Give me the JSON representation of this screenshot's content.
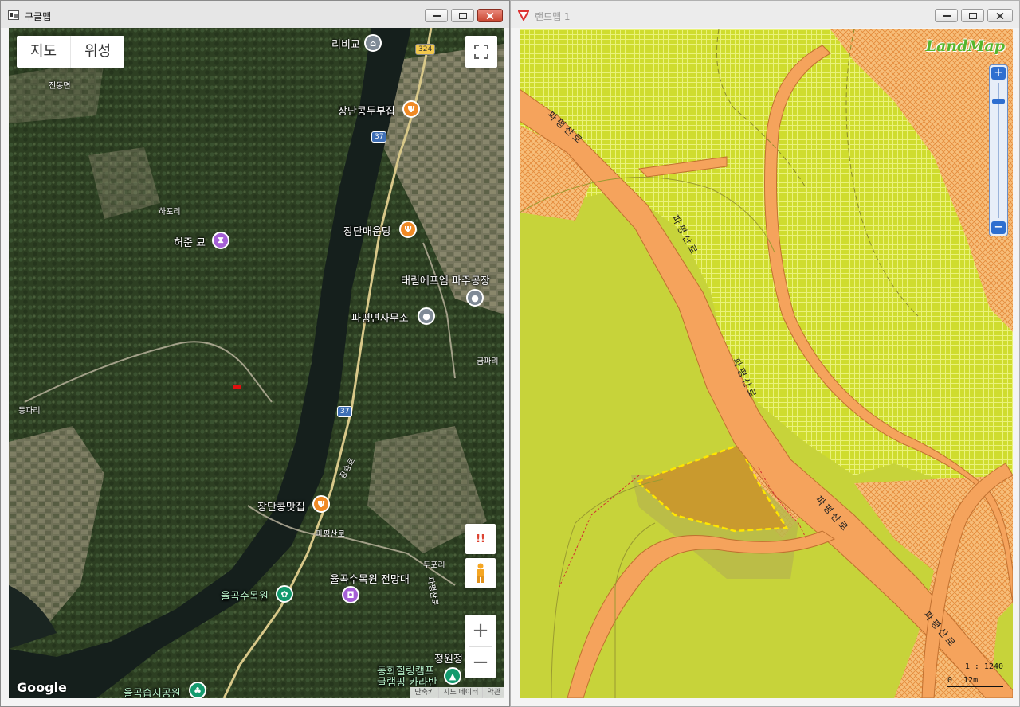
{
  "google_window": {
    "title": "구글맵",
    "map_type": {
      "map": "지도",
      "satellite": "위성"
    },
    "pois": [
      {
        "id": "ribigyo",
        "label": "리비교",
        "kind": "gray"
      },
      {
        "id": "jangdan-kongdubu",
        "label": "장단콩두부집",
        "kind": "orange"
      },
      {
        "id": "jangdan-maeun",
        "label": "장단매운탕",
        "kind": "orange"
      },
      {
        "id": "taerim",
        "label": "태림에프엠 파주공장",
        "kind": "gray"
      },
      {
        "id": "papyeong-office",
        "label": "파평면사무소",
        "kind": "gray"
      },
      {
        "id": "heojun",
        "label": "허준 묘",
        "kind": "purple"
      },
      {
        "id": "jangdan-kongmat",
        "label": "장단콩맛집",
        "kind": "orange"
      },
      {
        "id": "yulgok-arboretum",
        "label": "율곡수목원",
        "kind": "teal"
      },
      {
        "id": "yulgok-observatory",
        "label": "율곡수목원 전망대",
        "kind": "purple"
      },
      {
        "id": "yulgok-wetland",
        "label": "율곡습지공원",
        "kind": "teal"
      },
      {
        "id": "donghwa-camp",
        "label": "동화힐링캠프\n글램핑 카라반",
        "kind": "teal"
      },
      {
        "id": "jeongwon",
        "label": "정원정",
        "kind": "orange"
      }
    ],
    "place_labels": [
      "진동면",
      "하포리",
      "동파리",
      "금파리",
      "두포리",
      "파평산로",
      "장승로",
      "파평산로"
    ],
    "route_shields": [
      "324",
      "37",
      "37"
    ],
    "google_logo": "Google",
    "footer": [
      "단축키",
      "지도 데이터",
      "약관"
    ],
    "controls": {
      "fullscreen": "fullscreen-icon",
      "alert": "!!",
      "pegman": "pegman-icon",
      "zoom_in": "+",
      "zoom_out": "−"
    }
  },
  "land_window": {
    "title": "랜드맵 1",
    "logo": "LandMap",
    "road_labels": [
      "파평산로",
      "파평산로",
      "파평산로",
      "파평산로",
      "파평산로"
    ],
    "scale_text": "1 : 1240",
    "scale_zero": "0",
    "scale_unit": "12m",
    "zoom": {
      "in": "+",
      "out": "−"
    }
  },
  "colors": {
    "landmap_yellow": "#c7d33a",
    "landmap_road": "#f5a35c",
    "landmap_orange_zone": "#f7be7a",
    "landmap_parcel": "#c99a2e",
    "google_orange_pin": "#f08a26"
  }
}
